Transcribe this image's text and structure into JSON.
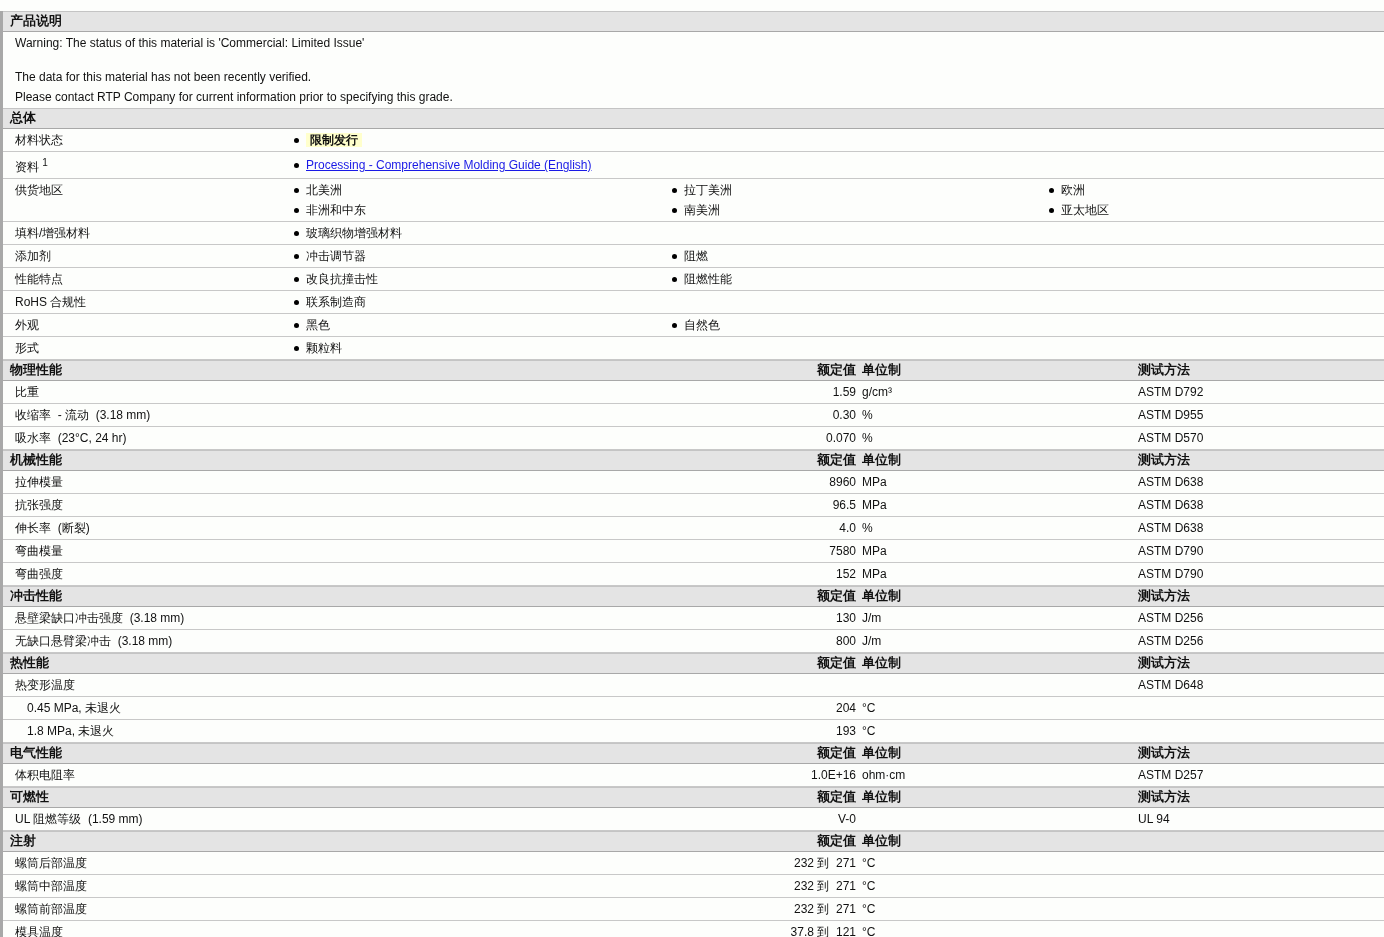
{
  "description": {
    "title": "产品说明",
    "paragraphs": [
      [
        "Warning: The status of this material is 'Commercial: Limited Issue'"
      ],
      [
        "The data for this material has not been recently verified.",
        "Please contact RTP Company for current information prior to specifying this grade."
      ]
    ]
  },
  "general": {
    "title": "总体",
    "rows": [
      {
        "label": "材料状态",
        "items": [
          {
            "text": "限制发行",
            "kind": "highlight"
          }
        ]
      },
      {
        "label": "资料 $^{1}$",
        "items": [
          {
            "text": "Processing - Comprehensive Molding Guide (English)",
            "kind": "link"
          }
        ]
      },
      {
        "label": "供货地区",
        "items": [
          {
            "text": "北美洲",
            "kind": "plain"
          },
          {
            "text": "拉丁美洲",
            "kind": "plain"
          },
          {
            "text": "欧洲",
            "kind": "plain"
          },
          {
            "text": "非洲和中东",
            "kind": "plain"
          },
          {
            "text": "南美洲",
            "kind": "plain"
          },
          {
            "text": "亚太地区",
            "kind": "plain"
          }
        ]
      },
      {
        "label": "填料/增强材料",
        "items": [
          {
            "text": "玻璃织物增强材料",
            "kind": "plain"
          }
        ]
      },
      {
        "label": "添加剂",
        "items": [
          {
            "text": "冲击调节器",
            "kind": "plain"
          },
          {
            "text": "阻燃",
            "kind": "plain"
          }
        ]
      },
      {
        "label": "性能特点",
        "items": [
          {
            "text": "改良抗撞击性",
            "kind": "plain"
          },
          {
            "text": "阻燃性能",
            "kind": "plain"
          }
        ]
      },
      {
        "label": "RoHS 合规性",
        "items": [
          {
            "text": "联系制造商",
            "kind": "plain"
          }
        ]
      },
      {
        "label": "外观",
        "items": [
          {
            "text": "黑色",
            "kind": "plain"
          },
          {
            "text": "自然色",
            "kind": "plain"
          }
        ]
      },
      {
        "label": "形式",
        "items": [
          {
            "text": "颗粒料",
            "kind": "plain"
          }
        ]
      }
    ]
  },
  "sections": [
    {
      "title": "物理性能",
      "columns": [
        "额定值",
        "单位制",
        "测试方法"
      ],
      "rows": [
        {
          "label": "比重",
          "value": "1.59",
          "unit": "g/cm³",
          "method": "ASTM D792"
        },
        {
          "label": "收缩率  - 流动  (3.18 mm)",
          "value": "0.30",
          "unit": "%",
          "method": "ASTM D955"
        },
        {
          "label": "吸水率  (23°C, 24 hr)",
          "value": "0.070",
          "unit": "%",
          "method": "ASTM D570"
        }
      ]
    },
    {
      "title": "机械性能",
      "columns": [
        "额定值",
        "单位制",
        "测试方法"
      ],
      "rows": [
        {
          "label": "拉伸模量",
          "value": "8960",
          "unit": "MPa",
          "method": "ASTM D638"
        },
        {
          "label": "抗张强度",
          "value": "96.5",
          "unit": "MPa",
          "method": "ASTM D638"
        },
        {
          "label": "伸长率  (断裂)",
          "value": "4.0",
          "unit": "%",
          "method": "ASTM D638"
        },
        {
          "label": "弯曲模量",
          "value": "7580",
          "unit": "MPa",
          "method": "ASTM D790"
        },
        {
          "label": "弯曲强度",
          "value": "152",
          "unit": "MPa",
          "method": "ASTM D790"
        }
      ]
    },
    {
      "title": "冲击性能",
      "columns": [
        "额定值",
        "单位制",
        "测试方法"
      ],
      "rows": [
        {
          "label": "悬壁梁缺口冲击强度  (3.18 mm)",
          "value": "130",
          "unit": "J/m",
          "method": "ASTM D256"
        },
        {
          "label": "无缺口悬臂梁冲击  (3.18 mm)",
          "value": "800",
          "unit": "J/m",
          "method": "ASTM D256"
        }
      ]
    },
    {
      "title": "热性能",
      "columns": [
        "额定值",
        "单位制",
        "测试方法"
      ],
      "rows": [
        {
          "label": "热变形温度",
          "method": "ASTM D648",
          "children": [
            {
              "label": "0.45 MPa, 未退火",
              "value": "204",
              "unit": "°C"
            },
            {
              "label": "1.8 MPa, 未退火",
              "value": "193",
              "unit": "°C"
            }
          ]
        }
      ]
    },
    {
      "title": "电气性能",
      "columns": [
        "额定值",
        "单位制",
        "测试方法"
      ],
      "rows": [
        {
          "label": "体积电阻率",
          "value": "1.0E+16",
          "unit": "ohm·cm",
          "method": "ASTM D257"
        }
      ]
    },
    {
      "title": "可燃性",
      "columns": [
        "额定值",
        "单位制",
        "测试方法"
      ],
      "rows": [
        {
          "label": "UL 阻燃等级  (1.59 mm)",
          "value": "V-0",
          "method": "UL 94"
        }
      ]
    },
    {
      "title": "注射",
      "columns": [
        "额定值",
        "单位制"
      ],
      "rows": [
        {
          "label": "螺筒后部温度",
          "value": "232 到  271",
          "unit": "°C"
        },
        {
          "label": "螺筒中部温度",
          "value": "232 到  271",
          "unit": "°C"
        },
        {
          "label": "螺筒前部温度",
          "value": "232 到  271",
          "unit": "°C"
        },
        {
          "label": "模具温度",
          "value": "37.8 到  121",
          "unit": "°C"
        }
      ]
    }
  ]
}
